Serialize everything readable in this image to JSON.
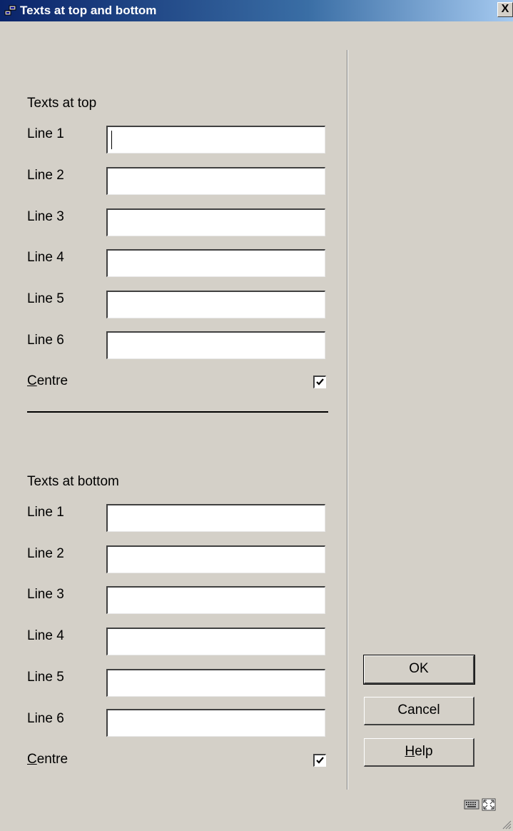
{
  "window": {
    "title": "Texts at top and bottom",
    "close_label": "X",
    "icon": "window-app-icon",
    "title_gradient": [
      "#0a246a",
      "#a6caf0"
    ],
    "background": "#d4d0c8"
  },
  "top_section": {
    "heading": "Texts at top",
    "lines": [
      {
        "label": "Line 1",
        "value": ""
      },
      {
        "label": "Line 2",
        "value": ""
      },
      {
        "label": "Line 3",
        "value": ""
      },
      {
        "label": "Line 4",
        "value": ""
      },
      {
        "label": "Line 5",
        "value": ""
      },
      {
        "label": "Line 6",
        "value": ""
      }
    ],
    "centre": {
      "mnemonic": "C",
      "rest": "entre",
      "checked": true
    }
  },
  "bottom_section": {
    "heading": "Texts at bottom",
    "lines": [
      {
        "label": "Line 1",
        "value": ""
      },
      {
        "label": "Line 2",
        "value": ""
      },
      {
        "label": "Line 3",
        "value": ""
      },
      {
        "label": "Line 4",
        "value": ""
      },
      {
        "label": "Line 5",
        "value": ""
      },
      {
        "label": "Line 6",
        "value": ""
      }
    ],
    "centre": {
      "mnemonic": "C",
      "rest": "entre",
      "checked": true
    }
  },
  "buttons": {
    "ok": "OK",
    "cancel": "Cancel",
    "help_mnemonic": "H",
    "help_rest": "elp"
  },
  "status_bar": {
    "icons": [
      "keyboard-icon",
      "maximize-icon",
      "resize-grip-icon"
    ]
  }
}
